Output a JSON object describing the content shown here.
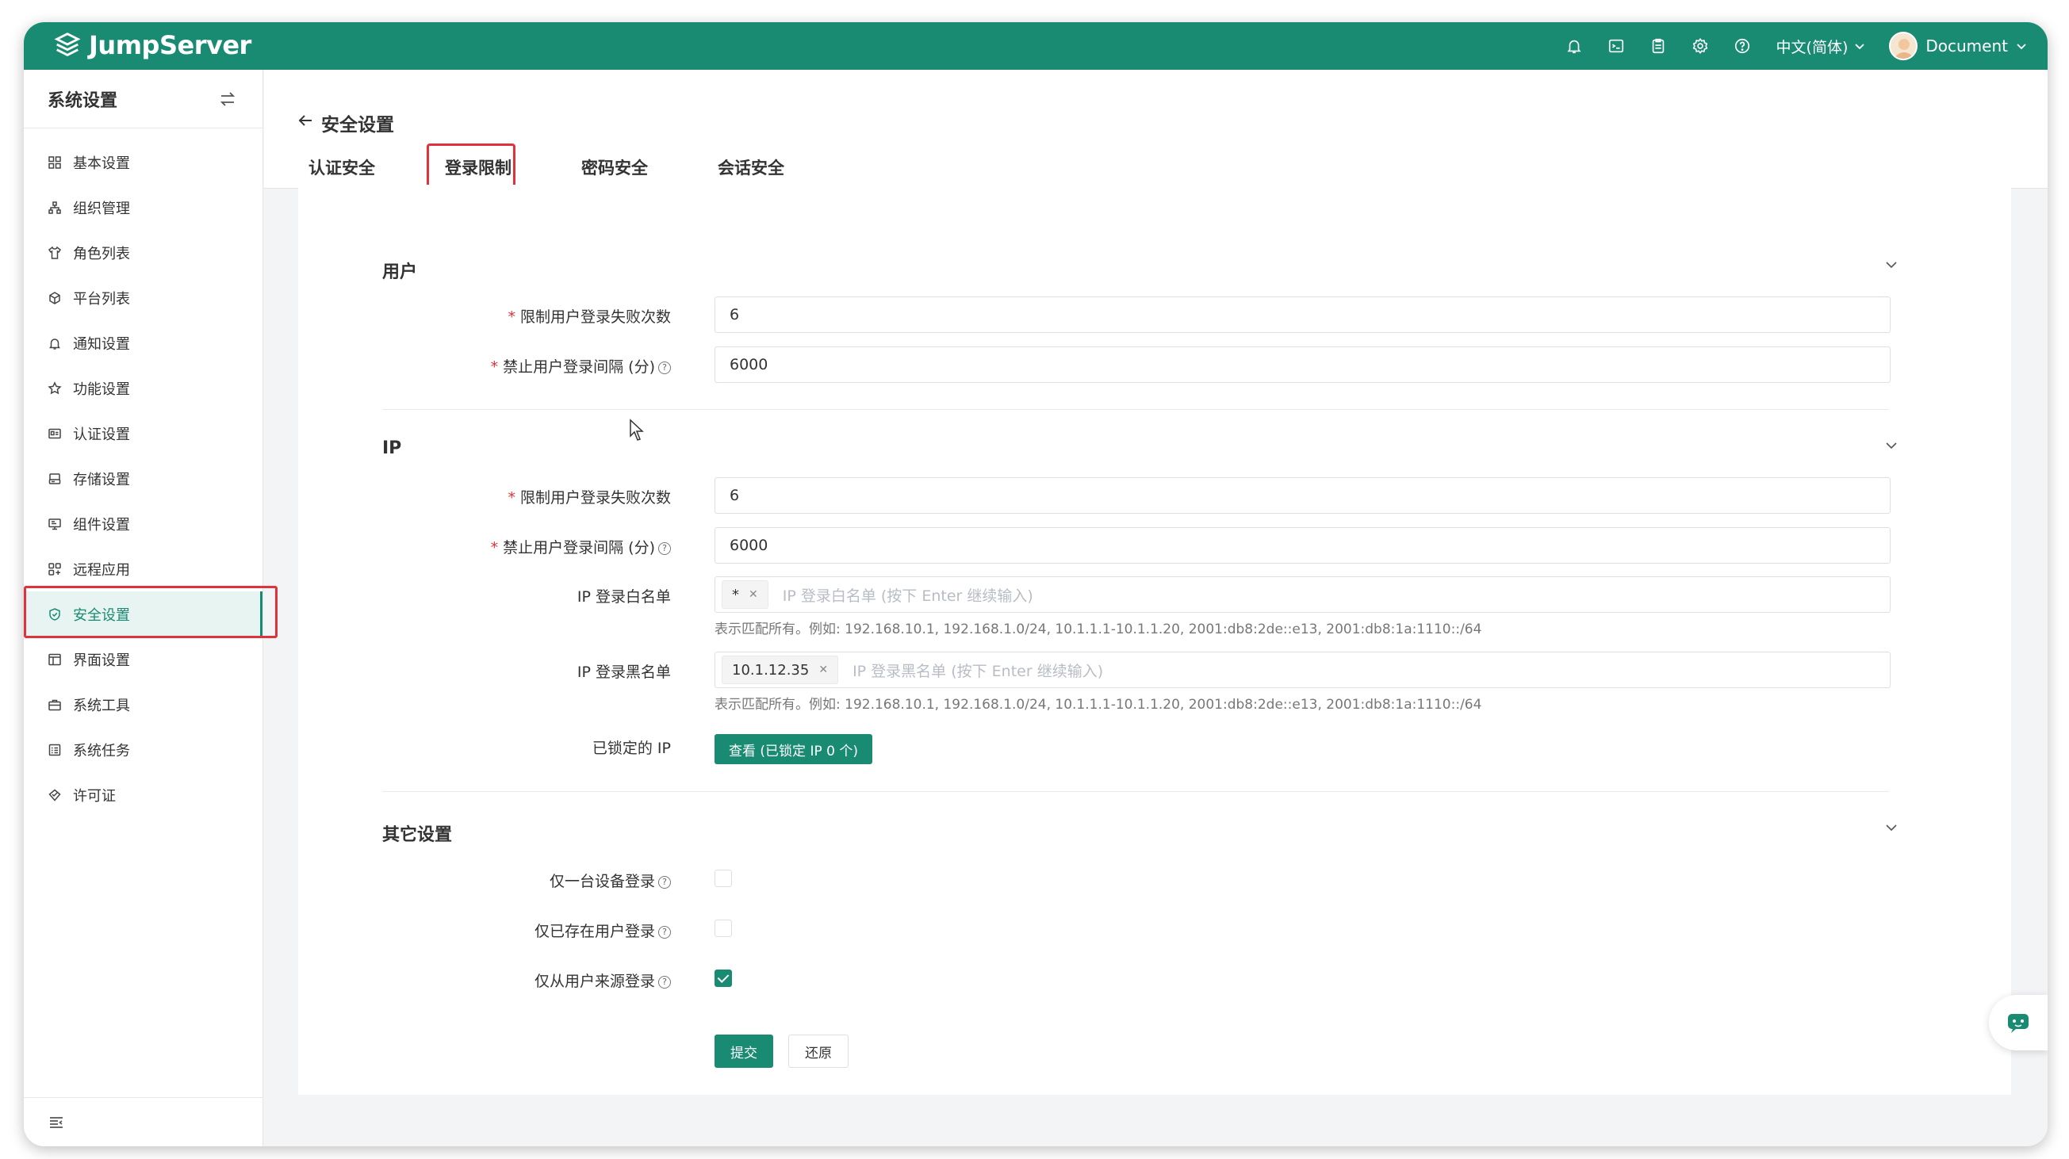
{
  "app": {
    "brand": "JumpServer",
    "accent": "#1a8b73",
    "highlight": "#e0323b"
  },
  "topbar": {
    "icons": [
      "bell-icon",
      "terminal-icon",
      "clipboard-icon",
      "gear-icon",
      "help-icon"
    ],
    "language": "中文(简体)",
    "user": "Document"
  },
  "sidebar": {
    "title": "系统设置",
    "items": [
      {
        "label": "基本设置",
        "icon": "grid-icon"
      },
      {
        "label": "组织管理",
        "icon": "org-icon"
      },
      {
        "label": "角色列表",
        "icon": "shirt-icon"
      },
      {
        "label": "平台列表",
        "icon": "cube-icon"
      },
      {
        "label": "通知设置",
        "icon": "bell-icon"
      },
      {
        "label": "功能设置",
        "icon": "star-icon"
      },
      {
        "label": "认证设置",
        "icon": "id-card-icon"
      },
      {
        "label": "存储设置",
        "icon": "storage-icon"
      },
      {
        "label": "组件设置",
        "icon": "monitor-icon"
      },
      {
        "label": "远程应用",
        "icon": "apps-icon"
      },
      {
        "label": "安全设置",
        "icon": "shield-icon",
        "active": true
      },
      {
        "label": "界面设置",
        "icon": "layout-icon"
      },
      {
        "label": "系统工具",
        "icon": "toolbox-icon"
      },
      {
        "label": "系统任务",
        "icon": "task-icon"
      },
      {
        "label": "许可证",
        "icon": "license-icon"
      }
    ]
  },
  "page": {
    "title": "安全设置",
    "tabs": [
      "认证安全",
      "登录限制",
      "密码安全",
      "会话安全"
    ],
    "active_tab": "登录限制"
  },
  "form": {
    "user_section": {
      "title": "用户",
      "fail_count_label": "限制用户登录失败次数",
      "fail_count_value": "6",
      "block_interval_label": "禁止用户登录间隔 (分)",
      "block_interval_value": "6000"
    },
    "ip_section": {
      "title": "IP",
      "fail_count_label": "限制用户登录失败次数",
      "fail_count_value": "6",
      "block_interval_label": "禁止用户登录间隔 (分)",
      "block_interval_value": "6000",
      "whitelist_label": "IP 登录白名单",
      "whitelist_tag": "*",
      "whitelist_placeholder": "IP 登录白名单 (按下 Enter 继续输入)",
      "whitelist_help": "表示匹配所有。例如: 192.168.10.1, 192.168.1.0/24, 10.1.1.1-10.1.1.20, 2001:db8:2de::e13, 2001:db8:1a:1110::/64",
      "blacklist_label": "IP 登录黑名单",
      "blacklist_tag": "10.1.12.35",
      "blacklist_placeholder": "IP 登录黑名单 (按下 Enter 继续输入)",
      "blacklist_help": "表示匹配所有。例如: 192.168.10.1, 192.168.1.0/24, 10.1.1.1-10.1.1.20, 2001:db8:2de::e13, 2001:db8:1a:1110::/64",
      "locked_label": "已锁定的 IP",
      "locked_button": "查看 (已锁定 IP 0 个)"
    },
    "other_section": {
      "title": "其它设置",
      "single_device_label": "仅一台设备登录",
      "single_device_checked": false,
      "existing_user_label": "仅已存在用户登录",
      "existing_user_checked": false,
      "user_source_label": "仅从用户来源登录",
      "user_source_checked": true
    },
    "submit_label": "提交",
    "reset_label": "还原"
  }
}
